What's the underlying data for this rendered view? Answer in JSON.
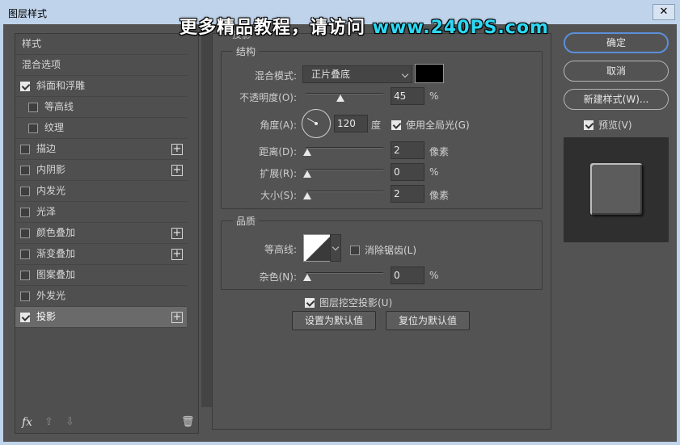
{
  "window": {
    "title": "图层样式",
    "close_glyph": "✕"
  },
  "watermark": {
    "text": "更多精品教程，请访问 ",
    "url": "www.240PS.com"
  },
  "left_panel": {
    "items": [
      {
        "label": "样式",
        "checkbox": false,
        "checked": false,
        "plus": false,
        "indent": 0,
        "selected": false
      },
      {
        "label": "混合选项",
        "checkbox": false,
        "checked": false,
        "plus": false,
        "indent": 0,
        "selected": false
      },
      {
        "label": "斜面和浮雕",
        "checkbox": true,
        "checked": true,
        "plus": false,
        "indent": 0,
        "selected": false
      },
      {
        "label": "等高线",
        "checkbox": true,
        "checked": false,
        "plus": false,
        "indent": 1,
        "selected": false
      },
      {
        "label": "纹理",
        "checkbox": true,
        "checked": false,
        "plus": false,
        "indent": 1,
        "selected": false
      },
      {
        "label": "描边",
        "checkbox": true,
        "checked": false,
        "plus": true,
        "indent": 0,
        "selected": false
      },
      {
        "label": "内阴影",
        "checkbox": true,
        "checked": false,
        "plus": true,
        "indent": 0,
        "selected": false
      },
      {
        "label": "内发光",
        "checkbox": true,
        "checked": false,
        "plus": false,
        "indent": 0,
        "selected": false
      },
      {
        "label": "光泽",
        "checkbox": true,
        "checked": false,
        "plus": false,
        "indent": 0,
        "selected": false
      },
      {
        "label": "颜色叠加",
        "checkbox": true,
        "checked": false,
        "plus": true,
        "indent": 0,
        "selected": false
      },
      {
        "label": "渐变叠加",
        "checkbox": true,
        "checked": false,
        "plus": true,
        "indent": 0,
        "selected": false
      },
      {
        "label": "图案叠加",
        "checkbox": true,
        "checked": false,
        "plus": false,
        "indent": 0,
        "selected": false
      },
      {
        "label": "外发光",
        "checkbox": true,
        "checked": false,
        "plus": false,
        "indent": 0,
        "selected": false
      },
      {
        "label": "投影",
        "checkbox": true,
        "checked": true,
        "plus": true,
        "indent": 0,
        "selected": true
      }
    ],
    "plus_glyph": "+",
    "fx_label": "fx",
    "up_glyph": "⇧",
    "down_glyph": "⇩",
    "trash_glyph": "🗑"
  },
  "drop_shadow": {
    "section_title": "投影",
    "structure": {
      "title": "结构",
      "blend_mode_label": "混合模式:",
      "blend_mode_value": "正片叠底",
      "shadow_color": "#000000",
      "opacity_label": "不透明度(O):",
      "opacity_value": "45",
      "opacity_fraction": 0.45,
      "percent": "%",
      "angle_label": "角度(A):",
      "angle_value": "120",
      "angle_unit": "度",
      "global_light_label": "使用全局光(G)",
      "global_light_checked": true,
      "distance_label": "距离(D):",
      "distance_value": "2",
      "distance_unit": "像素",
      "spread_label": "扩展(R):",
      "spread_value": "0",
      "size_label": "大小(S):",
      "size_value": "2",
      "size_unit": "像素"
    },
    "quality": {
      "title": "品质",
      "contour_label": "等高线:",
      "antialias_label": "消除锯齿(L)",
      "antialias_checked": false,
      "noise_label": "杂色(N):",
      "noise_value": "0"
    },
    "knockout_label": "图层挖空投影(U)",
    "knockout_checked": true,
    "set_default_label": "设置为默认值",
    "reset_default_label": "复位为默认值"
  },
  "right_panel": {
    "ok_label": "确定",
    "cancel_label": "取消",
    "new_style_label": "新建样式(W)...",
    "preview_label": "预览(V)",
    "preview_checked": true
  }
}
